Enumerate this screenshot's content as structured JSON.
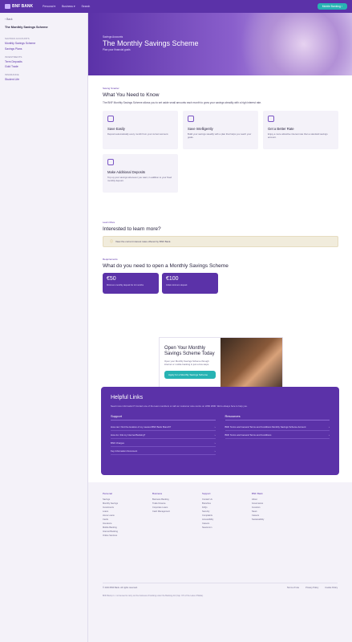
{
  "nav": {
    "logo": "BNF BANK",
    "items": [
      "Personal ▾",
      "Business ▾",
      "Search"
    ],
    "cta": "Mobile Banking ›"
  },
  "sidebar": {
    "back": "‹  Back",
    "title": "The Monthly Savings Scheme",
    "sections": [
      {
        "heading": "Savings Accounts",
        "links": [
          "Monthly Savings Scheme",
          "Savings Plans"
        ]
      },
      {
        "heading": "Investments",
        "links": [
          "Term Deposits",
          "Gold Trade"
        ]
      },
      {
        "heading": "Insurance",
        "links": [
          "Student Life"
        ]
      }
    ]
  },
  "hero": {
    "eyebrow": "Savings Accounts",
    "title": "The Monthly Savings Scheme",
    "subtitle": "Plan your financial goals"
  },
  "know": {
    "eyebrow": "Saving Smarter",
    "title": "What You Need to Know",
    "desc": "The BNF Monthly Savings Scheme allows you to set aside small amounts each month to grow your savings steadily with a high interest rate.",
    "cards": [
      {
        "icon": "calendar-icon",
        "title": "Save Easily",
        "text": "Deposit automatically every month from your current account."
      },
      {
        "icon": "lightbulb-icon",
        "title": "Save Intelligently",
        "text": "Build your savings steadily with a plan that helps you reach your goals."
      },
      {
        "icon": "percent-icon",
        "title": "Get a Better Rate",
        "text": "Enjoy a more attractive interest rate than a standard savings account."
      },
      {
        "icon": "coins-icon",
        "title": "Make Additional Deposits",
        "text": "Top up your savings whenever you want, in addition to your fixed monthly deposit."
      }
    ]
  },
  "learn": {
    "eyebrow": "Learn More",
    "title": "Interested to learn more?",
    "notice": "View the current interest rates offered by BNF Bank."
  },
  "requirements": {
    "eyebrow": "Requirements",
    "title": "What do you need to open a Monthly Savings Scheme",
    "cards": [
      {
        "value": "€50",
        "text": "Minimum monthly deposit for 12 months"
      },
      {
        "value": "€100",
        "text": "Initial minimum deposit"
      }
    ]
  },
  "promo": {
    "title": "Open Your Monthly Savings Scheme Today",
    "text": "Open your Monthly Savings Scheme through internet or mobile banking in just a few steps.",
    "button": "Apply for a Monthly Savings Scheme"
  },
  "helpful": {
    "title": "Helpful Links",
    "desc": "Need more information? Contact one of the team members or call our customer care centre on 2260 2000. We're always here to help you.",
    "support": {
      "title": "Support",
      "links": [
        "How can I find the location of my nearest BNF Bank Branch?",
        "How do I link my Internet Banking?",
        "BNF Charges",
        "Key Information Document"
      ]
    },
    "resources": {
      "title": "Resources",
      "links": [
        "BNF Terms and General Terms and Conditions Monthly Savings Scheme Account",
        "BNF Terms and General Terms and Conditions"
      ]
    }
  },
  "footer": {
    "columns": [
      {
        "title": "Personal",
        "links": [
          "Savings",
          "Monthly Savings",
          "Investments",
          "Loans",
          "Home Loans",
          "Cards",
          "Insurance",
          "Mobile Banking",
          "Internet Banking",
          "Online Services"
        ]
      },
      {
        "title": "Business",
        "links": [
          "Business Banking",
          "Trade Finance",
          "Corporate Loans",
          "Cash Management"
        ]
      },
      {
        "title": "Support",
        "links": [
          "Contact Us",
          "Branches",
          "FAQs",
          "Security",
          "Complaints",
          "Accessibility",
          "Careers",
          "Newsroom"
        ]
      },
      {
        "title": "BNF Bank",
        "links": [
          "About",
          "Governance",
          "Investors",
          "News",
          "Careers",
          "Sustainability"
        ]
      }
    ],
    "copyright": "© 2024 BNF Bank. All rights reserved.",
    "bottom_links": [
      "Terms of Use",
      "Privacy Policy",
      "Cookie Policy"
    ],
    "legal": "BNF Bank p.l.c. is licensed to carry out the business of banking under the Banking Act (Cap. 371 of the Laws of Malta)."
  }
}
